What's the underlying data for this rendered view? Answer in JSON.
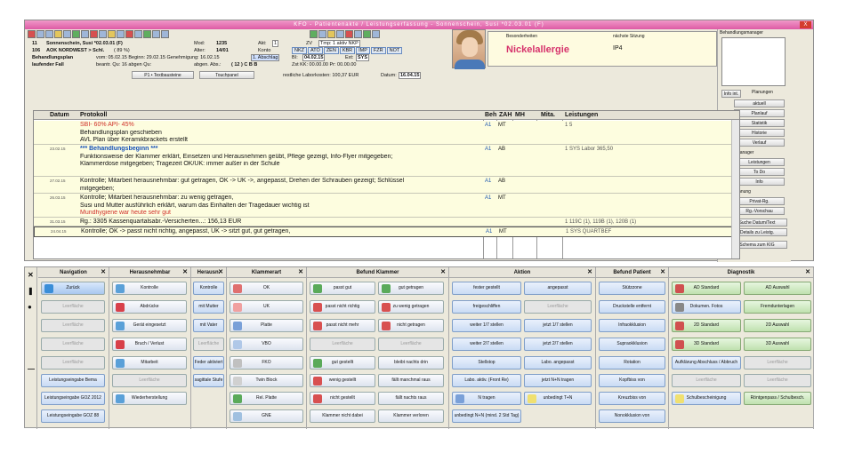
{
  "window": {
    "title": "KFO - Patientenakte / Leistungserfassung - Sonnenschein, Susi *02.03.01 (F)",
    "close": "X"
  },
  "patient": {
    "row1_num": "11",
    "row1_name": "Sonnenschein, Susi *02.03.01 (F)",
    "mod_label": "Mod:",
    "mod_val": "1235",
    "akt_label": "Akt:",
    "akt_val": "1",
    "zv": "ZV",
    "tmp": "Tmp: 1 aktiv NKP",
    "row2_num": "106",
    "row2_ins": "AOK NORDWEST > Schl.",
    "row2_ins_num": "( 89 %)",
    "alter_label": "Alter:",
    "alter_val": "14/01",
    "konto": "Konto",
    "abbrevs": [
      "NKZ",
      "ATO",
      "ZEN",
      "KBR",
      "IMP",
      "FZR",
      "NOT"
    ],
    "row3_label": "Behandlungsplan",
    "row3_text": "vom: 05.02.15  Beginn: 29.02.15  Genehmigung: 16.02.15",
    "abschlag": "1. Abschlag",
    "bi": "BI:",
    "bi_val": "04.02.15",
    "ext": "Ext:",
    "ext_val": "SYS",
    "row4_label": "laufender Fall",
    "row4_text": "beantr. Qu: 16  abgen Qu:",
    "row4_abgen": "abgen. Abs.:",
    "quarters": "( 12 )  C   B   B",
    "zst": "Zst KK: 00.00.00  Pr: 00.00.00",
    "btn_textbausteine": "P1 • Textbausteine",
    "btn_touchpanel": "Touchpanel",
    "labor": "restliche Laborkosten: 100,37 EUR",
    "datum_label": "Datum:",
    "datum_val": "16.04.15"
  },
  "besonder": {
    "h1": "Besonderheiten",
    "h2": "nächste Sitzung",
    "big": "Nickelallergie",
    "ip": "IP4"
  },
  "right": {
    "planung_label": "Behandlungsmanager",
    "info_btn": "Info int.",
    "planungen": "Planungen",
    "buttons": [
      "aktuell",
      "Planlauf",
      "Statistik",
      "Historie",
      "Verlauf"
    ],
    "beh_label": "Beh-Manager",
    "beh_buttons": [
      "Leistungen",
      "To Do",
      "Info"
    ],
    "abr_label": "Abrechnung",
    "abr_buttons": [
      "Privat-Rg.",
      "Rg.-Vorschau"
    ],
    "extra": [
      "Suche Datum/Text",
      "Details zu Leistg.",
      "Schema zum KIG"
    ]
  },
  "grid": {
    "headers": [
      "Datum",
      "Protokoll",
      "Beh",
      "ZAH",
      "MH",
      "Mita.",
      "Leistungen"
    ],
    "rows": [
      {
        "date": "",
        "lines": [
          {
            "t": "SBI- 60%  API- 45%",
            "c": "c-red"
          },
          {
            "t": "Behandlungsplan geschieben",
            "c": ""
          },
          {
            "t": "AVL Plan über Keramikbrackets erstellt",
            "c": ""
          }
        ],
        "beh": "A1",
        "zah": "MT",
        "lei": "1  5"
      },
      {
        "date": "23.02.15",
        "lines": [
          {
            "t": "*** Behandlungsbeginn ***",
            "c": "c-blue b"
          },
          {
            "t": "Funktionsweise der Klammer erklärt, Einsetzen und Herausnehmen geübt, Pflege gezeigt, Info-Flyer mitgegeben;",
            "c": ""
          },
          {
            "t": "Klammerdose mitgegeben;  Tragezeit OK/UK: immer außer in der Schule",
            "c": ""
          }
        ],
        "beh": "A1",
        "zah": "AB",
        "lei": "1  SYS   Labor 365,50"
      },
      {
        "date": "27.02.15",
        "lines": [
          {
            "t": "Kontrolle; Mitarbeit herausnehmbar: gut getragen, OK -> UK ->, angepasst, Drehen der Schrauben gezeigt; Schlüssel",
            "c": ""
          },
          {
            "t": "mitgegeben;",
            "c": ""
          }
        ],
        "beh": "A1",
        "zah": "AB",
        "lei": ""
      },
      {
        "date": "26.03.15",
        "lines": [
          {
            "t": "Kontrolle; Mitarbeit herausnehmbar: zu wenig getragen,",
            "c": ""
          },
          {
            "t": "Susi und Mutter ausführlich erklärt, warum das Einhalten der Tragedauer wichtig ist",
            "c": ""
          },
          {
            "t": "Mundhygiene war heute sehr gut",
            "c": "c-red"
          }
        ],
        "beh": "A1",
        "zah": "MT",
        "lei": ""
      },
      {
        "date": "31.03.15",
        "lines": [
          {
            "t": "Rg.: 3305 Kassenquartalsabr.-Versicherten...: 156,13 EUR",
            "c": ""
          }
        ],
        "beh": "",
        "zah": "",
        "lei": "1  119C  (1), 119B  (1), 120B  (1)"
      },
      {
        "date": "24.04.15",
        "lines": [
          {
            "t": "Kontrolle;  OK -> passt nicht richtig, angepasst, UK -> sitzt gut, gut getragen,",
            "c": ""
          }
        ],
        "beh": "A1",
        "zah": "MT",
        "lei": "1  SYS   QUARTBEF"
      }
    ]
  },
  "bottom": {
    "nav": {
      "title": "Navigation",
      "items": [
        "Zurück",
        "Leerfläche",
        "Leerfläche",
        "Leerfläche",
        "Leerfläche",
        "Leistungseingabe Bema",
        "Leistungseingabe GOZ 2012",
        "Leistungseingabe GOZ 88"
      ]
    },
    "heraus": {
      "title": "Herausnehmbar",
      "items": [
        "Kontrolle",
        "Abdrücke",
        "Gerät eingesetzt",
        "Bruch / Verlust",
        "Mitarbeit",
        "Leerfläche",
        "Wiederherstellung"
      ]
    },
    "herausn": {
      "title": "Herausn.",
      "items": [
        "Kontrolle",
        "mit Mutter",
        "mit Vater",
        "Leerfläche",
        "Feder aktiviert",
        "sagittale Stufe"
      ]
    },
    "klammer": {
      "title": "Klammerart",
      "items": [
        "OK",
        "UK",
        "Platte",
        "VBO",
        "FKO",
        "Twin Block",
        "Rel. Platte",
        "GNE"
      ]
    },
    "befundk": {
      "title": "Befund Klammer",
      "left": [
        "passt gut",
        "passt nicht richtig",
        "passt nicht mehr",
        "Leerfläche",
        "gut gestellt",
        "wenig gestellt",
        "nicht gestellt",
        "Klammer nicht dabei"
      ],
      "right": [
        "gut getragen",
        "zu wenig getragen",
        "nicht getragen",
        "Leerfläche",
        "bleibt nachts drin",
        "fällt manchmal raus",
        "fällt nachts raus",
        "Klammer verloren"
      ]
    },
    "aktion": {
      "title": "Aktion",
      "left": [
        "fester gestellt",
        "freigeschliffen",
        "weiter 1/7 stellen",
        "weiter 2/7 stellen",
        "Stellstop",
        "Labo. aktiv. (Front Re)",
        "N tragen",
        "unbedingt N+N (mind. 2 Std Tag)"
      ],
      "right": [
        "angepasst",
        "Leerfläche",
        "jetzt 1/7 stellen",
        "jetzt 2/7 stellen",
        "Labo. angepasst",
        "jetzt N+N tragen",
        "unbedingt T+N",
        ""
      ]
    },
    "befundp": {
      "title": "Befund Patient",
      "items": [
        "Stützzone",
        "Druckstelle entfernt",
        "Infraokklusion",
        "Supraokklusion",
        "Rotation",
        "Kopfbiss von",
        "Kreuzbiss von",
        "Nonokklusion von"
      ]
    },
    "diag": {
      "title": "Diagnostik",
      "left": [
        "AD Standard",
        "Dokumen. Fotos",
        "2D Standard",
        "3D Standard",
        "Aufklärung Abschluss / Abbruch",
        "Leerfläche",
        "Schulbescheinigung"
      ],
      "right": [
        "AD Auswahl",
        "Fremdunterlagen",
        "2D Auswahl",
        "3D Auswahl",
        "Leerfläche",
        "Leerfläche",
        "Röntgenpass / Schulbesch."
      ]
    }
  },
  "colors": {
    "title": "#dd5aa4",
    "red": "#d0302a",
    "green": "#1f9f32",
    "row": "#fdfddf"
  }
}
